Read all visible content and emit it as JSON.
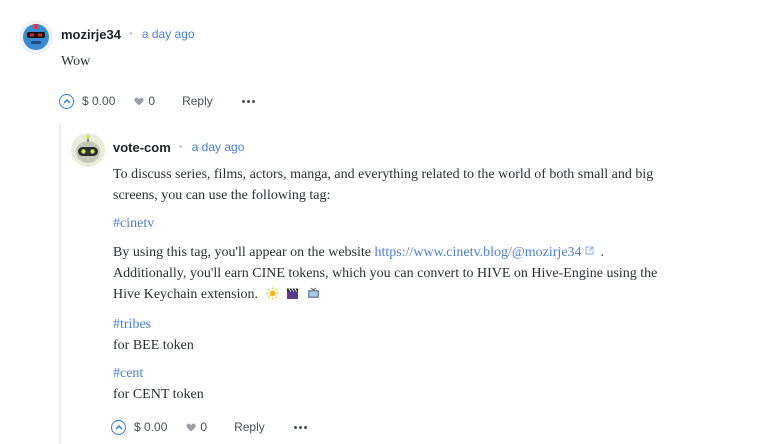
{
  "comment": {
    "author": "mozirje34",
    "time": "a day ago",
    "text": "Wow",
    "actions": {
      "payout": "$ 0.00",
      "likes": "0",
      "reply_label": "Reply"
    }
  },
  "reply": {
    "author": "vote-com",
    "time": "a day ago",
    "para1": "To discuss series, films, actors, manga, and everything related to the world of both small and big screens, you can use the following tag:",
    "tag_cinetv": "#cinetv",
    "para2_start": "By using this tag, you'll appear on the website",
    "link_text": "https://www.cinetv.blog/@mozirje34",
    "para2_after_link": ".",
    "para2_rest": "Additionally, you'll earn CINE tokens, which you can convert to HIVE on Hive-Engine using the Hive Keychain extension.",
    "tag_tribes": "#tribes",
    "tribes_desc": "for BEE token",
    "tag_cent": "#cent",
    "cent_desc": "for CENT token",
    "actions": {
      "payout": "$ 0.00",
      "likes": "0",
      "reply_label": "Reply"
    }
  },
  "icons": {
    "upvote": "chevron-up-icon",
    "heart": "heart-icon",
    "more": "more-dots-icon",
    "external": "external-link-icon",
    "emojis": [
      "sun-icon",
      "clapperboard-icon",
      "tv-icon"
    ]
  },
  "colors": {
    "accent": "#4a7fd8",
    "upvote": "#2d7be5"
  }
}
